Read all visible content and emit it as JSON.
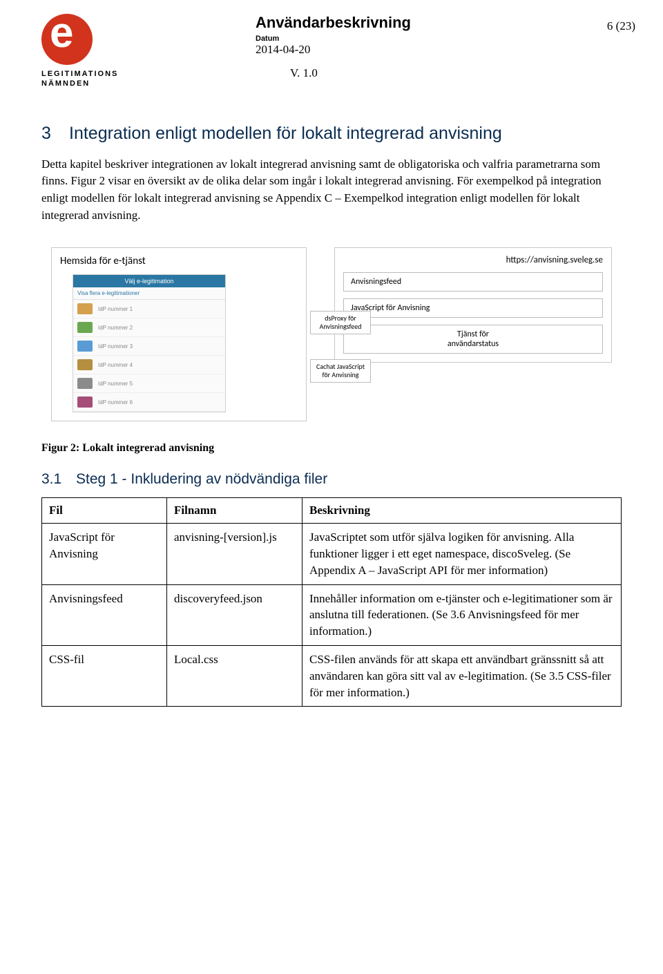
{
  "page_number": "6 (23)",
  "header": {
    "logo_text1": "LEGITIMATIONS",
    "logo_text2": "NÄMNDEN",
    "doc_title": "Användarbeskrivning",
    "datum_label": "Datum",
    "date": "2014-04-20",
    "version": "V. 1.0"
  },
  "section3": {
    "num": "3",
    "title": "Integration enligt modellen för lokalt integrerad anvisning",
    "p1": "Detta kapitel beskriver integrationen av lokalt integrerad anvisning samt de obligatoriska och valfria parametrarna som finns. Figur 2 visar en översikt av de olika delar som ingår i lokalt integrerad anvisning. För exempelkod på integration enligt modellen för lokalt integrerad anvisning se Appendix C – Exempelkod integration enligt modellen för lokalt integrerad anvisning."
  },
  "diagram": {
    "left_title": "Hemsida för e-tjänst",
    "panel_header": "Välj e-legitimation",
    "panel_sub": "Visa flera e-legitimationer",
    "rows": [
      "IdP nummer 1",
      "IdP nummer 2",
      "IdP nummer 3",
      "IdP nummer 4",
      "IdP nummer 5",
      "IdP nummer 6"
    ],
    "server_title": "https://anvisning.sveleg.se",
    "box_feed": "Anvisningsfeed",
    "box_js": "JavaScript för Anvisning",
    "box_status_l1": "Tjänst för",
    "box_status_l2": "användarstatus",
    "node_proxy_l1": "dsProxy för",
    "node_proxy_l2": "Anvisningsfeed",
    "node_cache_l1": "Cachat JavaScript",
    "node_cache_l2": "för Anvisning"
  },
  "fig_caption": "Figur 2: Lokalt integrerad anvisning",
  "section31": {
    "num": "3.1",
    "title": "Steg 1 - Inkludering av nödvändiga filer",
    "th_fil": "Fil",
    "th_filnamn": "Filnamn",
    "th_besk": "Beskrivning",
    "rows": [
      {
        "fil": "JavaScript för Anvisning",
        "filnamn": "anvisning-[version].js",
        "besk": "JavaScriptet som utför själva logiken för anvisning. Alla funktioner ligger i ett eget namespace, discoSveleg. (Se Appendix A – JavaScript API för mer information)"
      },
      {
        "fil": "Anvisningsfeed",
        "filnamn": "discoveryfeed.json",
        "besk": "Innehåller information om e-tjänster och e-legitimationer som är anslutna till federationen. (Se 3.6 Anvisningsfeed för mer information.)"
      },
      {
        "fil": "CSS-fil",
        "filnamn": "Local.css",
        "besk": "CSS-filen används för att skapa ett användbart gränssnitt så att användaren kan göra sitt val av e-legitimation. (Se 3.5 CSS-filer för mer information.)"
      }
    ]
  }
}
